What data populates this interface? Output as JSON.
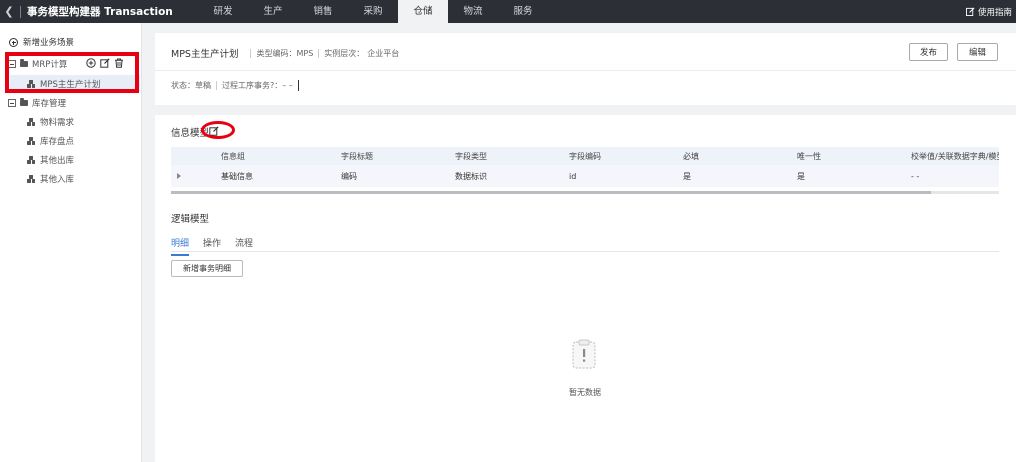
{
  "header": {
    "back_icon": "chevron-left-icon",
    "title": "事务模型构建器 Transaction",
    "tabs": [
      "研发",
      "生产",
      "销售",
      "采购",
      "仓储",
      "物流",
      "服务"
    ],
    "active_tab": "仓储",
    "guide_label": "使用指南",
    "guide_icon": "edit-doc-icon",
    "background": "#2c2f36"
  },
  "sidebar": {
    "add_scene_label": "新增业务场景",
    "tree": [
      {
        "label": "MRP计算",
        "children": [
          {
            "label": "MPS主生产计划",
            "selected": true
          }
        ]
      },
      {
        "label": "库存管理",
        "children": [
          {
            "label": "物料需求"
          },
          {
            "label": "库存盘点"
          },
          {
            "label": "其他出库"
          },
          {
            "label": "其他入库"
          }
        ]
      }
    ],
    "node_actions": [
      "add-circle-icon",
      "edit-icon",
      "delete-icon"
    ]
  },
  "detail": {
    "name": "MPS主生产计划",
    "type_code_label": "类型编码：MPS",
    "instance_level_label": "实例层次：",
    "instance_level_value": "企业平台",
    "publish_label": "发布",
    "edit_label": "编辑",
    "status_text": "状态：草稿",
    "process_text": "过程工序事务?：– –"
  },
  "info_model": {
    "title": "信息模型",
    "columns": [
      "",
      "信息组",
      "字段标题",
      "字段类型",
      "字段编码",
      "必填",
      "唯一性",
      "校举值/关联数据字典/模型"
    ],
    "rows": [
      [
        "",
        "基础信息",
        "编码",
        "数据标识",
        "id",
        "是",
        "是",
        "- -"
      ]
    ]
  },
  "logic_model": {
    "title": "逻辑模型",
    "tabs": [
      "明细",
      "操作",
      "流程"
    ],
    "active_tab": "明细",
    "add_detail_label": "新增事务明细",
    "empty_text": "暂无数据",
    "empty_icon": "empty-clipboard-icon"
  },
  "colors": {
    "accent": "#3b7bd4",
    "highlight_red": "#e60012",
    "selected_bg": "#e8eef8",
    "table_header_bg": "#eef2f9"
  }
}
